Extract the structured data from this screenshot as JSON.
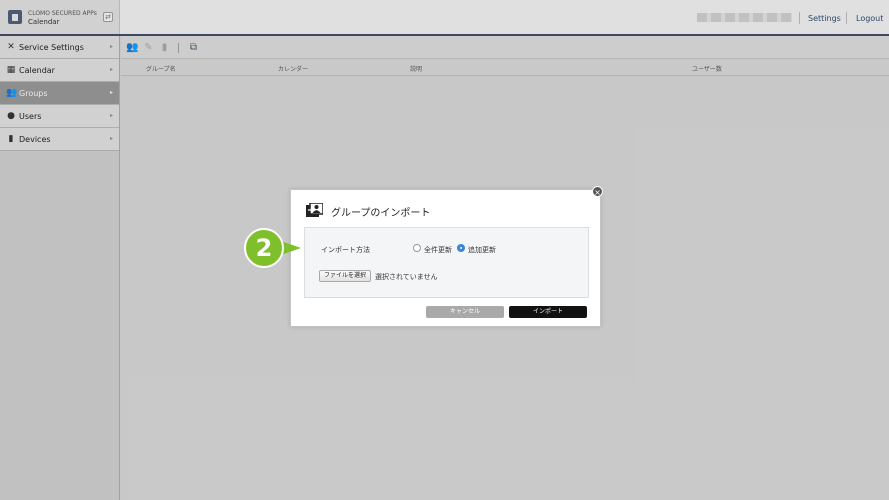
{
  "header": {
    "brand_line1": "CLOMO SECURED APPs",
    "brand_line2": "Calendar",
    "settings_label": "Settings",
    "logout_label": "Logout"
  },
  "sidebar": {
    "items": [
      {
        "label": "Service Settings",
        "icon": "tools-icon"
      },
      {
        "label": "Calendar",
        "icon": "calendar-icon"
      },
      {
        "label": "Groups",
        "icon": "group-icon",
        "active": true
      },
      {
        "label": "Users",
        "icon": "user-icon"
      },
      {
        "label": "Devices",
        "icon": "device-icon"
      }
    ]
  },
  "table": {
    "columns": [
      "グループ名",
      "カレンダー",
      "説明",
      "ユーザー数"
    ]
  },
  "modal": {
    "title": "グループのインポート",
    "method_label": "インポート方法",
    "options": [
      {
        "label": "全件更新",
        "checked": false
      },
      {
        "label": "追加更新",
        "checked": true
      }
    ],
    "file_button": "ファイルを選択",
    "file_status": "選択されていません",
    "cancel_label": "キャンセル",
    "import_label": "インポート"
  },
  "callout": {
    "number": "2",
    "color": "#7fbf2c"
  },
  "colors": {
    "header_accent": "#3d4d64",
    "active_nav": "#939393",
    "primary_button": "#111111",
    "radio_selected": "#3d86d8"
  }
}
